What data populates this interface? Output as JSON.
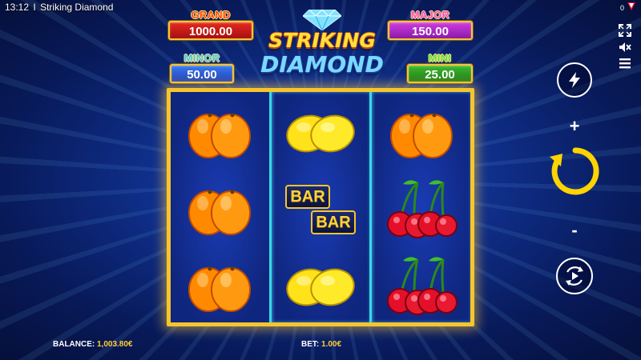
{
  "topbar": {
    "time": "13:12",
    "separator": "I",
    "title": "Striking Diamond",
    "counter": "0"
  },
  "jackpots": {
    "grand": {
      "label": "GRAND",
      "value": "1000.00"
    },
    "major": {
      "label": "MAJOR",
      "value": "150.00"
    },
    "minor": {
      "label": "MINOR",
      "value": "50.00"
    },
    "mini": {
      "label": "MINI",
      "value": "25.00"
    }
  },
  "logo": {
    "line1": "STRIKING",
    "line2": "DIAMOND"
  },
  "reels": [
    [
      "orange",
      "orange",
      "orange"
    ],
    [
      "lemon",
      "bar",
      "lemon"
    ],
    [
      "orange",
      "cherry",
      "cherry"
    ]
  ],
  "symbols": {
    "bar_text": "BAR"
  },
  "controls": {
    "plus": "+",
    "minus": "-"
  },
  "footer": {
    "balance_label": "BALANCE:",
    "balance_value": "1,003.80€",
    "bet_label": "BET:",
    "bet_value": "1.00€"
  },
  "colors": {
    "frame_gold": "#f7c52c",
    "reel_divider": "#38d7e8",
    "spin_yellow": "#ffd400",
    "footer_value": "#ffcf33"
  },
  "icons": {
    "fullscreen": "expand-icon",
    "sound": "mute-icon",
    "menu": "hamburger-icon",
    "turbo": "lightning-icon",
    "spin": "circular-arrow-icon",
    "autoplay": "autoplay-icon"
  }
}
